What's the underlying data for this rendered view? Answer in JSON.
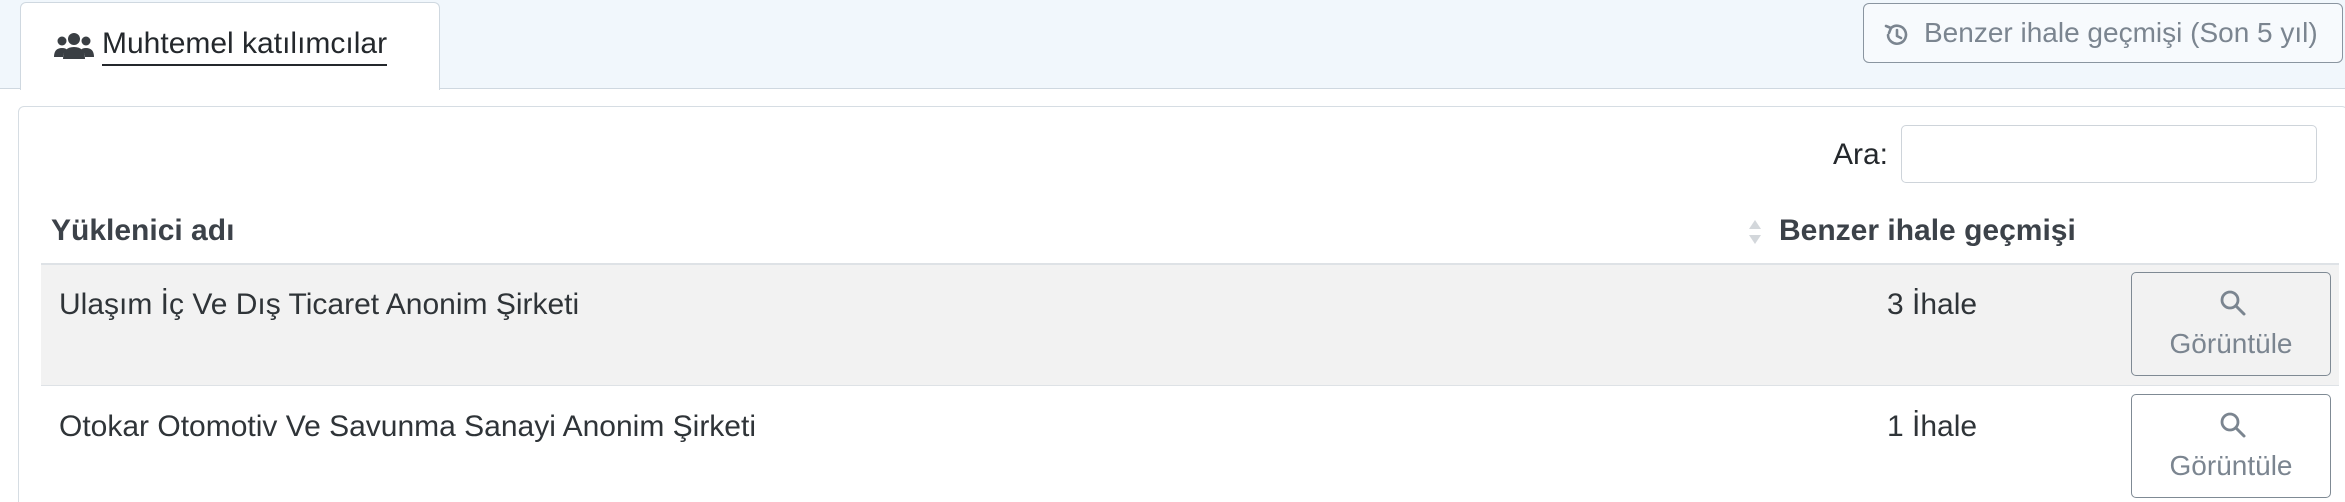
{
  "tabs": {
    "active_tab_label": "Muhtemel katılımcılar",
    "active_tab_icon": "users-icon",
    "history_button_label": "Benzer ihale geçmişi (Son 5 yıl)",
    "history_button_icon": "history-icon"
  },
  "search": {
    "label": "Ara:",
    "value": "",
    "placeholder": ""
  },
  "table": {
    "columns": [
      "Yüklenici adı",
      "Benzer ihale geçmişi"
    ],
    "rows": [
      {
        "name": "Ulaşım İç Ve Dış Ticaret Anonim Şirketi",
        "count": "3 İhale",
        "action_label": "Görüntüle",
        "action_icon": "search-icon"
      },
      {
        "name": "Otokar Otomotiv Ve Savunma Sanayi Anonim Şirketi",
        "count": "1 İhale",
        "action_label": "Görüntüle",
        "action_icon": "search-icon"
      }
    ]
  },
  "colors": {
    "tabbar_bg": "#f1f7fc",
    "striped_row_bg": "#f2f2f2",
    "muted_text": "#7b8590",
    "border": "#dee2e6"
  }
}
